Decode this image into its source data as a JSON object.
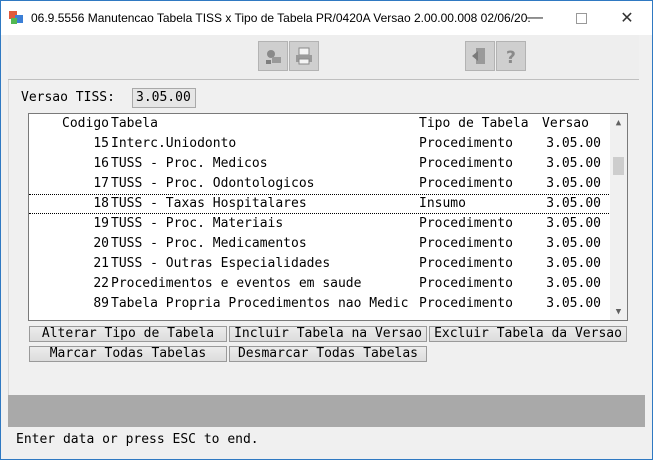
{
  "window": {
    "title": "06.9.5556 Manutencao Tabela TISS x Tipo de Tabela PR/0420A Versao 2.00.00.008 02/06/20...",
    "minimize_glyph": "—",
    "close_glyph": "✕"
  },
  "toolbar": {
    "icons": [
      "tool-icon",
      "printer-icon",
      "exit-icon",
      "help-icon"
    ]
  },
  "versao": {
    "label": "Versao TISS:",
    "value": "3.05.00"
  },
  "grid": {
    "columns": {
      "codigo": "Codigo",
      "tabela": "Tabela",
      "tipo": "Tipo de Tabela",
      "versao": "Versao"
    },
    "rows": [
      {
        "codigo": "15",
        "tabela": "Interc.Uniodonto",
        "tipo": "Procedimento",
        "versao": "3.05.00"
      },
      {
        "codigo": "16",
        "tabela": "TUSS - Proc. Medicos",
        "tipo": "Procedimento",
        "versao": "3.05.00"
      },
      {
        "codigo": "17",
        "tabela": "TUSS - Proc. Odontologicos",
        "tipo": "Procedimento",
        "versao": "3.05.00"
      },
      {
        "codigo": "18",
        "tabela": "TUSS - Taxas Hospitalares",
        "tipo": "Insumo",
        "versao": "3.05.00"
      },
      {
        "codigo": "19",
        "tabela": "TUSS - Proc. Materiais",
        "tipo": "Procedimento",
        "versao": "3.05.00"
      },
      {
        "codigo": "20",
        "tabela": "TUSS - Proc. Medicamentos",
        "tipo": "Procedimento",
        "versao": "3.05.00"
      },
      {
        "codigo": "21",
        "tabela": "TUSS - Outras Especialidades",
        "tipo": "Procedimento",
        "versao": "3.05.00"
      },
      {
        "codigo": "22",
        "tabela": "Procedimentos e eventos em saude",
        "tipo": "Procedimento",
        "versao": "3.05.00"
      },
      {
        "codigo": "89",
        "tabela": "Tabela Propria Procedimentos nao Medic",
        "tipo": "Procedimento",
        "versao": "3.05.00"
      }
    ],
    "selected_index": 3
  },
  "buttons": {
    "alterar": "Alterar Tipo de Tabela",
    "incluir": "Incluir Tabela na Versao",
    "excluir": "Excluir Tabela da Versao",
    "marcar": "Marcar Todas Tabelas",
    "desmarcar": "Desmarcar Todas Tabelas"
  },
  "status": {
    "message": "Enter data or press ESC to end."
  }
}
